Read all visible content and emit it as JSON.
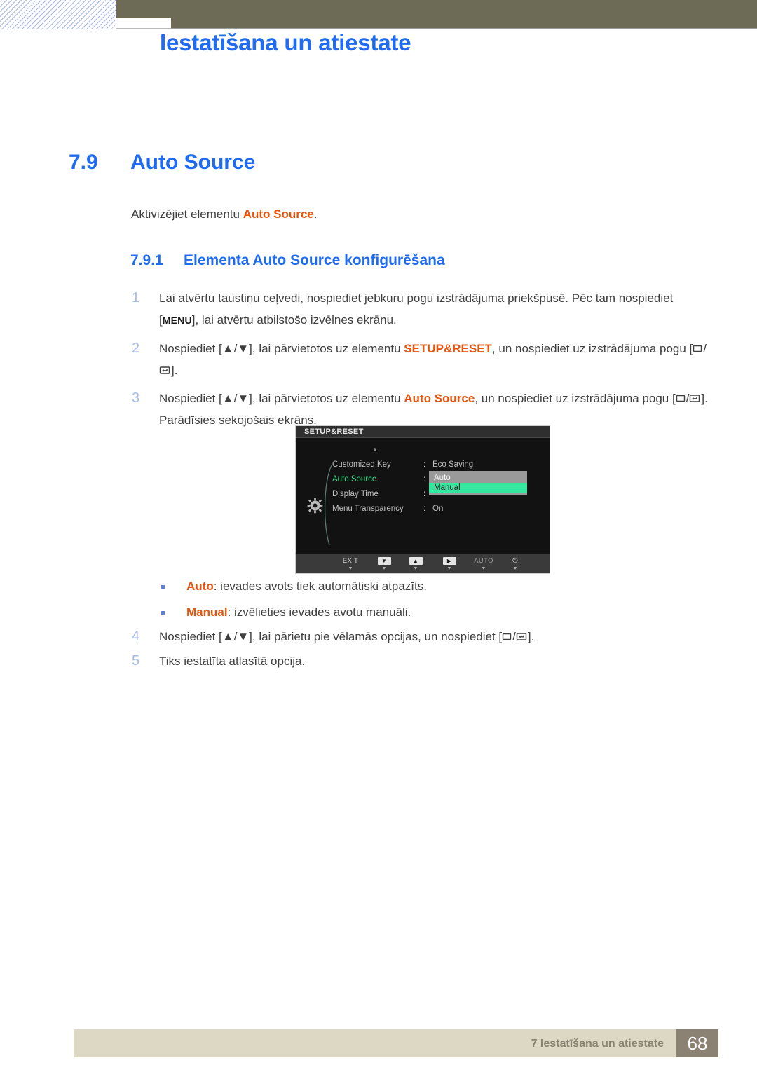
{
  "header": {
    "title": "Iestatīšana un atiestate"
  },
  "section": {
    "number": "7.9",
    "title": "Auto Source",
    "intro_prefix": "Aktivizējiet elementu ",
    "intro_highlight": "Auto Source",
    "intro_suffix": ".",
    "sub_number": "7.9.1",
    "sub_title": "Elementa Auto Source konfigurēšana"
  },
  "steps": [
    {
      "num": "1",
      "part1": "Lai atvērtu taustiņu ceļvedi, nospiediet jebkuru pogu izstrādājuma priekšpusē. Pēc tam nospiediet [",
      "key": "MENU",
      "part2": "], lai atvērtu atbilstošo izvēlnes ekrānu."
    },
    {
      "num": "2",
      "part1": "Nospiediet [",
      "keys": "▲/▼",
      "part2": "], lai pārvietotos uz elementu ",
      "highlight": "SETUP&RESET",
      "part3": ", un nospiediet uz izstrādājuma pogu [",
      "part4": "]."
    },
    {
      "num": "3",
      "part1": "Nospiediet [",
      "keys": "▲/▼",
      "part2": "], lai pārvietotos uz elementu ",
      "highlight": "Auto Source",
      "part3": ", un nospiediet uz izstrādājuma pogu [",
      "part4": "]. Parādīsies sekojošais ekrāns."
    }
  ],
  "bullets": [
    {
      "term": "Auto",
      "text": ": ievades avots tiek automātiski atpazīts."
    },
    {
      "term": "Manual",
      "text": ": izvēlieties ievades avotu manuāli."
    }
  ],
  "steps_late": [
    {
      "num": "4",
      "part1": "Nospiediet [",
      "keys": "▲/▼",
      "part2": "], lai pārietu pie vēlamās opcijas, un nospiediet [",
      "part3": "]."
    },
    {
      "num": "5",
      "part1": "Tiks iestatīta atlasītā opcija."
    }
  ],
  "osd": {
    "title": "SETUP&RESET",
    "rows": [
      {
        "label": "Customized Key",
        "colon": ":",
        "value": "Eco Saving",
        "active": false
      },
      {
        "label": "Auto Source",
        "colon": ":",
        "value": "",
        "active": true
      },
      {
        "label": "Display Time",
        "colon": ":",
        "value": "",
        "active": false
      },
      {
        "label": "Menu Transparency",
        "colon": ":",
        "value": "On",
        "active": false
      }
    ],
    "dropdown": {
      "unselected": "Auto",
      "selected": "Manual"
    },
    "footer_keys": [
      {
        "label": "EXIT",
        "type": "text",
        "tick": "▼"
      },
      {
        "label": "▼",
        "type": "box",
        "tick": "▼"
      },
      {
        "label": "▲",
        "type": "box",
        "tick": "▼"
      },
      {
        "label": "▶",
        "type": "box",
        "tick": "▼"
      },
      {
        "label": "AUTO",
        "type": "text-dim",
        "tick": "▼"
      },
      {
        "label": "⏻",
        "type": "power",
        "tick": "▼"
      }
    ]
  },
  "footer": {
    "chapter": "7 Iestatīšana un atiestate",
    "page": "68"
  },
  "colors": {
    "heading_blue": "#1f6bf2",
    "highlight_orange": "#e8540c",
    "header_band": "#6d6b55",
    "osd_green": "#35e08f",
    "footer_bar": "#ddd8c4",
    "footer_page_box": "#8c8274",
    "step_number": "#a7bce6"
  }
}
